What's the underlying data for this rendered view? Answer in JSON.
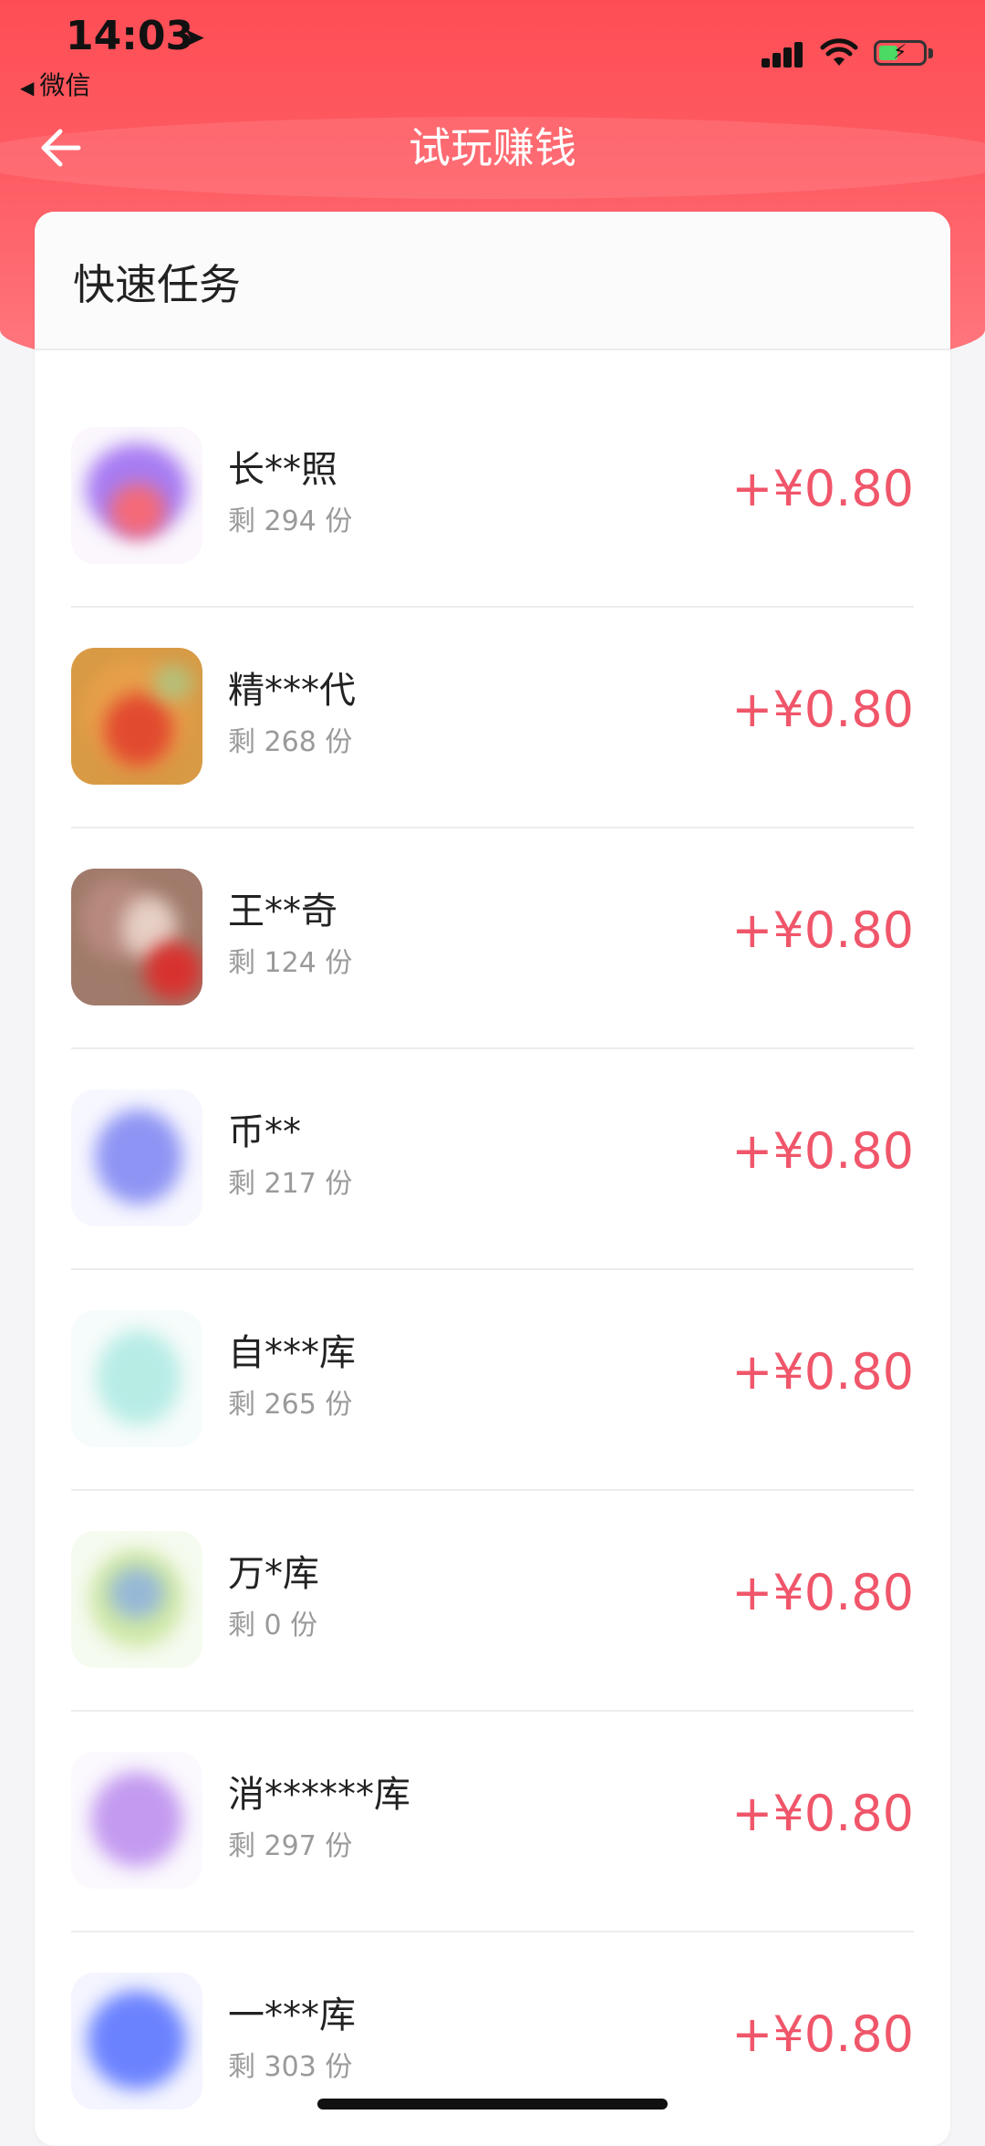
{
  "status_bar": {
    "time": "14:03",
    "back_app": "微信"
  },
  "nav": {
    "title": "试玩赚钱"
  },
  "section": {
    "title": "快速任务"
  },
  "tasks": [
    {
      "name": "长**照",
      "remaining": "剩 294 份",
      "reward": "+¥0.80",
      "icon": "app-icon-purple-red"
    },
    {
      "name": "精***代",
      "remaining": "剩 268 份",
      "reward": "+¥0.80",
      "icon": "app-icon-orange-red"
    },
    {
      "name": "王**奇",
      "remaining": "剩 124 份",
      "reward": "+¥0.80",
      "icon": "app-icon-brown-red"
    },
    {
      "name": "币**",
      "remaining": "剩 217 份",
      "reward": "+¥0.80",
      "icon": "app-icon-blue"
    },
    {
      "name": "自***库",
      "remaining": "剩 265 份",
      "reward": "+¥0.80",
      "icon": "app-icon-teal"
    },
    {
      "name": "万*库",
      "remaining": "剩 0 份",
      "reward": "+¥0.80",
      "icon": "app-icon-green-blue"
    },
    {
      "name": "消******库",
      "remaining": "剩 297 份",
      "reward": "+¥0.80",
      "icon": "app-icon-lavender"
    },
    {
      "name": "一***库",
      "remaining": "剩 303 份",
      "reward": "+¥0.80",
      "icon": "app-icon-royal-blue"
    }
  ],
  "colors": {
    "header": "#fe4d55",
    "reward": "#f0566a"
  }
}
